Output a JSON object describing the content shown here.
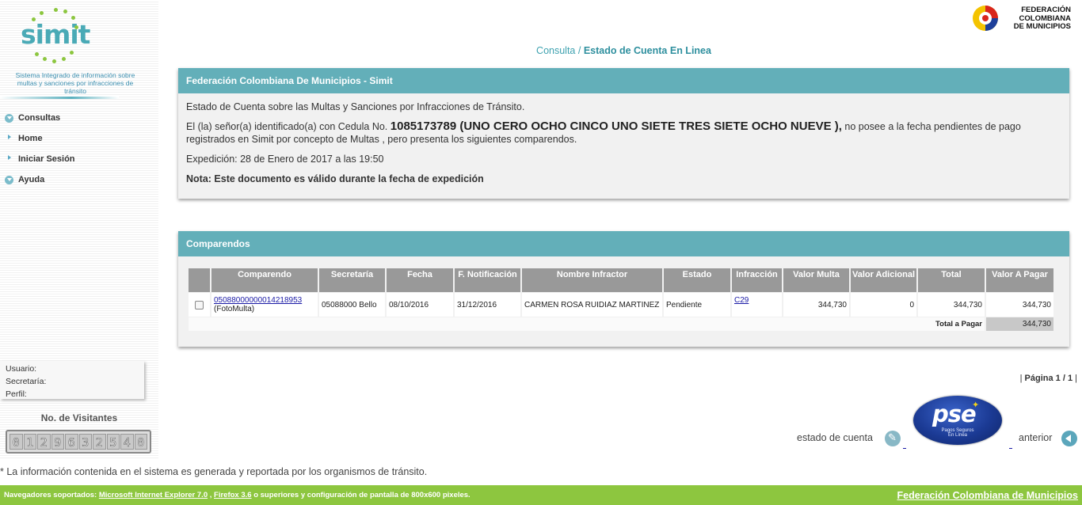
{
  "sidebar": {
    "logo_text": "simit",
    "tagline": "Sistema Integrado de información sobre multas y sanciones por infracciones de tránsito",
    "nav": [
      {
        "label": "Consultas",
        "icon": "circle-arrow-down-icon"
      },
      {
        "label": "Home",
        "icon": "triangle-bullet-icon"
      },
      {
        "label": "Iniciar Sesión",
        "icon": "triangle-bullet-icon"
      },
      {
        "label": "Ayuda",
        "icon": "circle-arrow-down-icon"
      }
    ],
    "user_info": {
      "usuario": "Usuario:",
      "secretaria": "Secretaría:",
      "perfil": "Perfil:"
    },
    "visitors_title": "No. de Visitantes",
    "visitors_digits": [
      "0",
      "1",
      "2",
      "9",
      "6",
      "3",
      "2",
      "5",
      "4",
      "0"
    ]
  },
  "header": {
    "org_name_lines": [
      "FEDERACIÓN",
      "COLOMBIANA",
      "DE MUNICIPIOS"
    ],
    "breadcrumb_1": "Consulta /",
    "breadcrumb_2": "Estado de Cuenta En Linea"
  },
  "panel1": {
    "title": "Federación Colombiana De Municipios - Simit",
    "intro": "Estado de Cuenta sobre las Multas y Sanciones por Infracciones de Tránsito.",
    "id_prefix": "El (la) señor(a) identificado(a) con Cedula No.",
    "id_value": "1085173789 (UNO CERO OCHO CINCO UNO SIETE TRES SIETE OCHO NUEVE ),",
    "id_suffix": "no posee a la fecha pendientes de pago registrados en Simit por concepto de Multas , pero presenta los siguientes comparendos.",
    "expedition": "Expedición: 28 de Enero de 2017 a las 19:50",
    "note": "Nota: Este documento es válido durante la fecha de expedición"
  },
  "panel2": {
    "title": "Comparendos",
    "columns": [
      "Comparendo",
      "Secretaría",
      "Fecha",
      "F. Notificación",
      "Nombre Infractor",
      "Estado",
      "Infracción",
      "Valor Multa",
      "Valor Adicional",
      "Total",
      "Valor A Pagar"
    ],
    "row": {
      "comparendo": "05088000000014218953",
      "comparendo_type": "(FotoMulta)",
      "secretaria": "05088000 Bello",
      "fecha": "08/10/2016",
      "f_notificacion": "31/12/2016",
      "nombre": "CARMEN ROSA RUIDIAZ MARTINEZ",
      "estado": "Pendiente",
      "infraccion": "C29",
      "valor_multa": "344,730",
      "valor_adicional": "0",
      "total": "344,730",
      "valor_a_pagar": "344,730"
    },
    "total_label": "Total a Pagar",
    "total_value": "344,730"
  },
  "pager": {
    "prefix": "| ",
    "label": "Página 1 / 1",
    "suffix": "  |"
  },
  "actions": {
    "estado_label": "estado de cuenta",
    "pse_mark": "pse",
    "pse_sub_1": "Pagos Seguros",
    "pse_sub_2": "En Línea",
    "anterior_label": "anterior"
  },
  "disclaimer": "* La información contenida en el sistema es generada y reportada por los organismos de tránsito.",
  "footer": {
    "prefix": "Navegadores soportados: ",
    "ie": "Microsoft Internet Explorer 7.0",
    "sep": " , ",
    "ff": "Firefox 3.6",
    "suffix": " o superiores y configuración de pantalla de 800x600 pixeles.",
    "org_link": "Federación Colombiana de Municipios"
  },
  "colors": {
    "teal": "#63afb9",
    "green": "#8dc63f",
    "header_gray": "#999999"
  }
}
